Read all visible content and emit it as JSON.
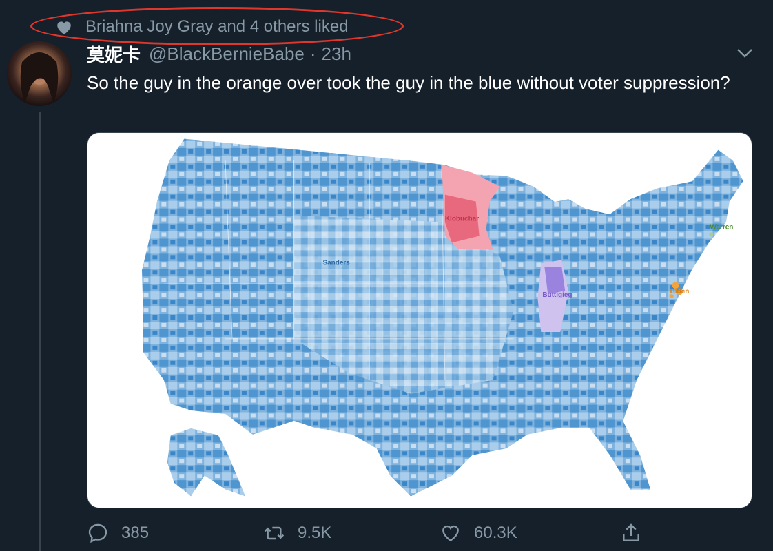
{
  "social_context": {
    "text": "Briahna Joy Gray and 4 others liked",
    "icon": "heart-icon"
  },
  "tweet": {
    "author_name": "莫妮卡",
    "handle": "@BlackBernieBabe",
    "separator": "·",
    "time": "23h",
    "text": "So the guy in the orange over took the guy in the blue without voter suppression?",
    "media": {
      "type": "map",
      "labels": {
        "sanders": "Sanders",
        "klobuchar": "Klobuchar",
        "warren": "Warren",
        "buttigieg": "Buttigieg",
        "biden": "Biden"
      },
      "colors": {
        "sanders": "#5b9bd5",
        "klobuchar": "#e0566b",
        "warren": "#5a9a3a",
        "buttigieg": "#8a6fd1",
        "biden": "#e8901e"
      }
    }
  },
  "actions": {
    "reply_count": "385",
    "retweet_count": "9.5K",
    "like_count": "60.3K"
  },
  "annotation": {
    "oval_color": "#e0372c"
  }
}
